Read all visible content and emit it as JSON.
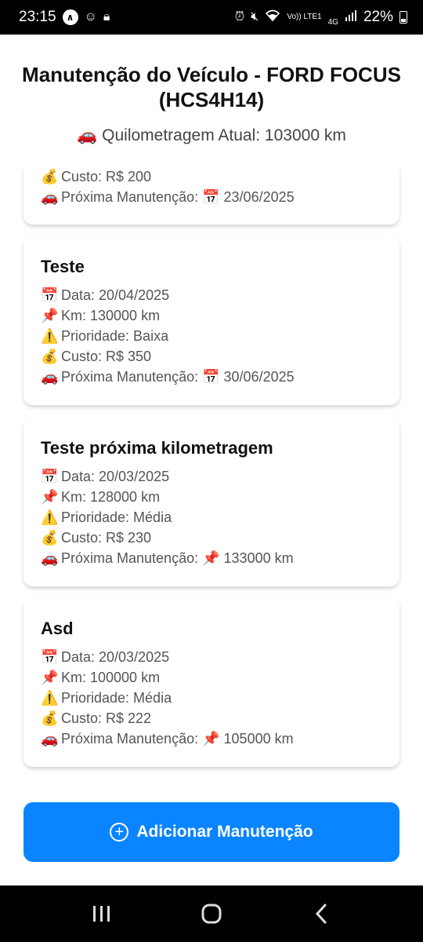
{
  "status_bar": {
    "time": "23:15",
    "network_label": "Vo)) LTE1",
    "network_gen": "4G",
    "battery": "22%"
  },
  "header": {
    "title": "Manutenção do Veículo - FORD FOCUS (HCS4H14)",
    "mileage_emoji": "🚗",
    "mileage": "Quilometragem Atual: 103000 km"
  },
  "emojis": {
    "date": "📅",
    "km": "📌",
    "priority": "⚠️",
    "cost": "💰",
    "next": "🚗"
  },
  "partial_card": {
    "cost": "Custo: R$ 200",
    "next_label": "Próxima Manutenção: ",
    "next_emoji": "📅",
    "next_value": "23/06/2025"
  },
  "cards": [
    {
      "title": "Teste",
      "date": "Data: 20/04/2025",
      "km": "Km: 130000 km",
      "priority": "Prioridade: Baixa",
      "cost": "Custo: R$ 350",
      "next_label": "Próxima Manutenção: ",
      "next_emoji": "📅",
      "next_value": "30/06/2025"
    },
    {
      "title": "Teste próxima kilometragem",
      "date": "Data: 20/03/2025",
      "km": "Km: 128000 km",
      "priority": "Prioridade: Média",
      "cost": "Custo: R$ 230",
      "next_label": "Próxima Manutenção: ",
      "next_emoji": "📌",
      "next_value": "133000 km"
    },
    {
      "title": "Asd",
      "date": "Data: 20/03/2025",
      "km": "Km: 100000 km",
      "priority": "Prioridade: Média",
      "cost": "Custo: R$ 222",
      "next_label": "Próxima Manutenção: ",
      "next_emoji": "📌",
      "next_value": "105000 km"
    }
  ],
  "add_button": {
    "label": "Adicionar Manutenção",
    "icon": "plus-circle-icon",
    "color": "#0a84ff"
  }
}
